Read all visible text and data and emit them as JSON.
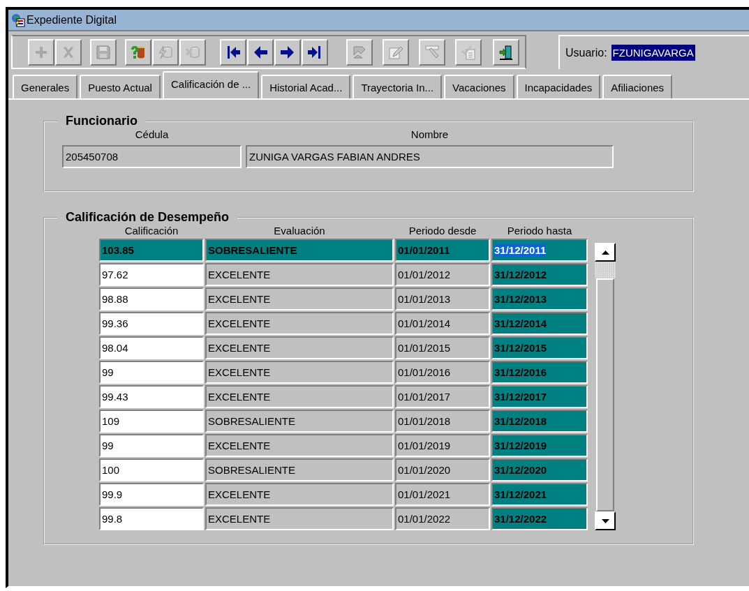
{
  "window": {
    "title": "Expediente Digital"
  },
  "toolbar": {
    "groups": [
      {
        "buttons": [
          {
            "disabled": true
          },
          {
            "disabled": true
          }
        ]
      },
      {
        "buttons": [
          {
            "disabled": true
          }
        ]
      },
      {
        "buttons": [
          {
            "disabled": false
          },
          {
            "disabled": true
          },
          {
            "disabled": true
          }
        ]
      },
      {
        "buttons": [
          {
            "disabled": false
          },
          {
            "disabled": false
          },
          {
            "disabled": false
          },
          {
            "disabled": false
          }
        ]
      },
      {
        "buttons": [
          {
            "disabled": true
          },
          {
            "disabled": true
          },
          {
            "disabled": true
          },
          {
            "disabled": true
          }
        ]
      },
      {
        "buttons": [
          {
            "disabled": false
          }
        ]
      }
    ]
  },
  "user": {
    "label": "Usuario:",
    "value": "FZUNIGAVARGA"
  },
  "tabs": [
    {
      "label": "Generales",
      "selected": false
    },
    {
      "label": "Puesto Actual",
      "selected": false
    },
    {
      "label": "Calificación de ...",
      "selected": true
    },
    {
      "label": "Historial Acad...",
      "selected": false
    },
    {
      "label": "Trayectoria In...",
      "selected": false
    },
    {
      "label": "Vacaciones",
      "selected": false
    },
    {
      "label": "Incapacidades",
      "selected": false
    },
    {
      "label": "Afiliaciones",
      "selected": false
    }
  ],
  "funcionario": {
    "title": "Funcionario",
    "cedula_label": "Cédula",
    "cedula": "205450708",
    "nombre_label": "Nombre",
    "nombre": "ZUNIGA VARGAS FABIAN ANDRES"
  },
  "calificaciones": {
    "title": "Calificación de Desempeño",
    "columns": [
      "Calificación",
      "Evaluación",
      "Periodo desde",
      "Periodo hasta"
    ],
    "rows": [
      {
        "calificacion": "103.85",
        "evaluacion": "SOBRESALIENTE",
        "desde": "01/01/2011",
        "hasta": "31/12/2011",
        "selected": true
      },
      {
        "calificacion": "97.62",
        "evaluacion": "EXCELENTE",
        "desde": "01/01/2012",
        "hasta": "31/12/2012",
        "selected": false
      },
      {
        "calificacion": "98.88",
        "evaluacion": "EXCELENTE",
        "desde": "01/01/2013",
        "hasta": "31/12/2013",
        "selected": false
      },
      {
        "calificacion": "99.36",
        "evaluacion": "EXCELENTE",
        "desde": "01/01/2014",
        "hasta": "31/12/2014",
        "selected": false
      },
      {
        "calificacion": "98.04",
        "evaluacion": "EXCELENTE",
        "desde": "01/01/2015",
        "hasta": "31/12/2015",
        "selected": false
      },
      {
        "calificacion": "99",
        "evaluacion": "EXCELENTE",
        "desde": "01/01/2016",
        "hasta": "31/12/2016",
        "selected": false
      },
      {
        "calificacion": "99.43",
        "evaluacion": "EXCELENTE",
        "desde": "01/01/2017",
        "hasta": "31/12/2017",
        "selected": false
      },
      {
        "calificacion": "109",
        "evaluacion": "SOBRESALIENTE",
        "desde": "01/01/2018",
        "hasta": "31/12/2018",
        "selected": false
      },
      {
        "calificacion": "99",
        "evaluacion": "EXCELENTE",
        "desde": "01/01/2019",
        "hasta": "31/12/2019",
        "selected": false
      },
      {
        "calificacion": "100",
        "evaluacion": "SOBRESALIENTE",
        "desde": "01/01/2020",
        "hasta": "31/12/2020",
        "selected": false
      },
      {
        "calificacion": "99.9",
        "evaluacion": "EXCELENTE",
        "desde": "01/01/2021",
        "hasta": "31/12/2021",
        "selected": false
      },
      {
        "calificacion": "99.8",
        "evaluacion": "EXCELENTE",
        "desde": "01/01/2022",
        "hasta": "31/12/2022",
        "selected": false
      }
    ]
  }
}
